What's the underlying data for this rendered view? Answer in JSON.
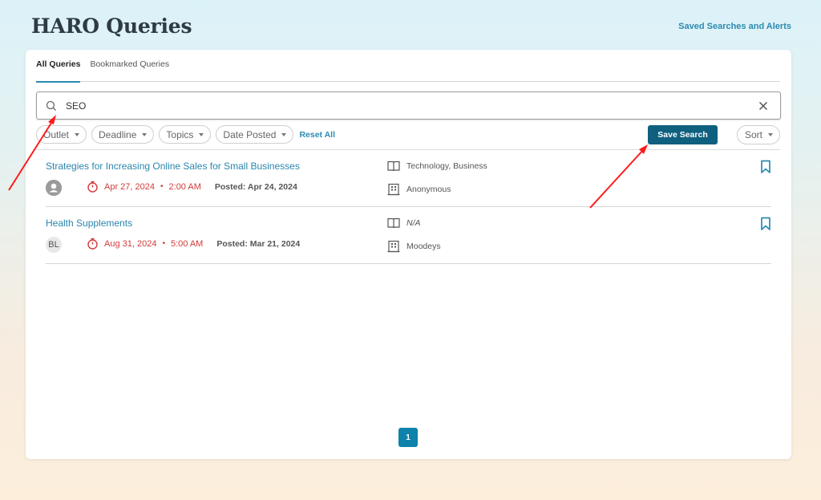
{
  "header": {
    "title": "HARO Queries",
    "saved_searches_link": "Saved Searches and Alerts"
  },
  "tabs": [
    {
      "label": "All Queries",
      "active": true
    },
    {
      "label": "Bookmarked Queries",
      "active": false
    }
  ],
  "search": {
    "value": "SEO",
    "icon": "search-icon",
    "clear_icon": "close-icon"
  },
  "filters": [
    {
      "label": "Outlet"
    },
    {
      "label": "Deadline"
    },
    {
      "label": "Topics"
    },
    {
      "label": "Date Posted"
    }
  ],
  "reset_all_label": "Reset All",
  "save_search_label": "Save Search",
  "sort_label": "Sort",
  "queries": [
    {
      "title": "Strategies for Increasing Online Sales for Small Businesses",
      "avatar": "generic-user-icon",
      "deadline_date": "Apr 27, 2024",
      "deadline_separator": "•",
      "deadline_time": "2:00 AM",
      "posted": "Posted: Apr 24, 2024",
      "topics": "Technology, Business",
      "outlet": "Anonymous",
      "bookmarked": false
    },
    {
      "title": "Health Supplements",
      "avatar": "BL",
      "deadline_date": "Aug 31, 2024",
      "deadline_separator": "•",
      "deadline_time": "5:00 AM",
      "posted": "Posted: Mar 21, 2024",
      "topics": "N/A",
      "outlet": "Moodeys",
      "bookmarked": false
    }
  ],
  "pagination": {
    "current_page": "1"
  },
  "colors": {
    "accent": "#2b8bb0",
    "primary_button": "#0f5f7e",
    "deadline": "#d33a3a",
    "page_active": "#0e82ab",
    "annotation_arrow": "#ff0000"
  }
}
